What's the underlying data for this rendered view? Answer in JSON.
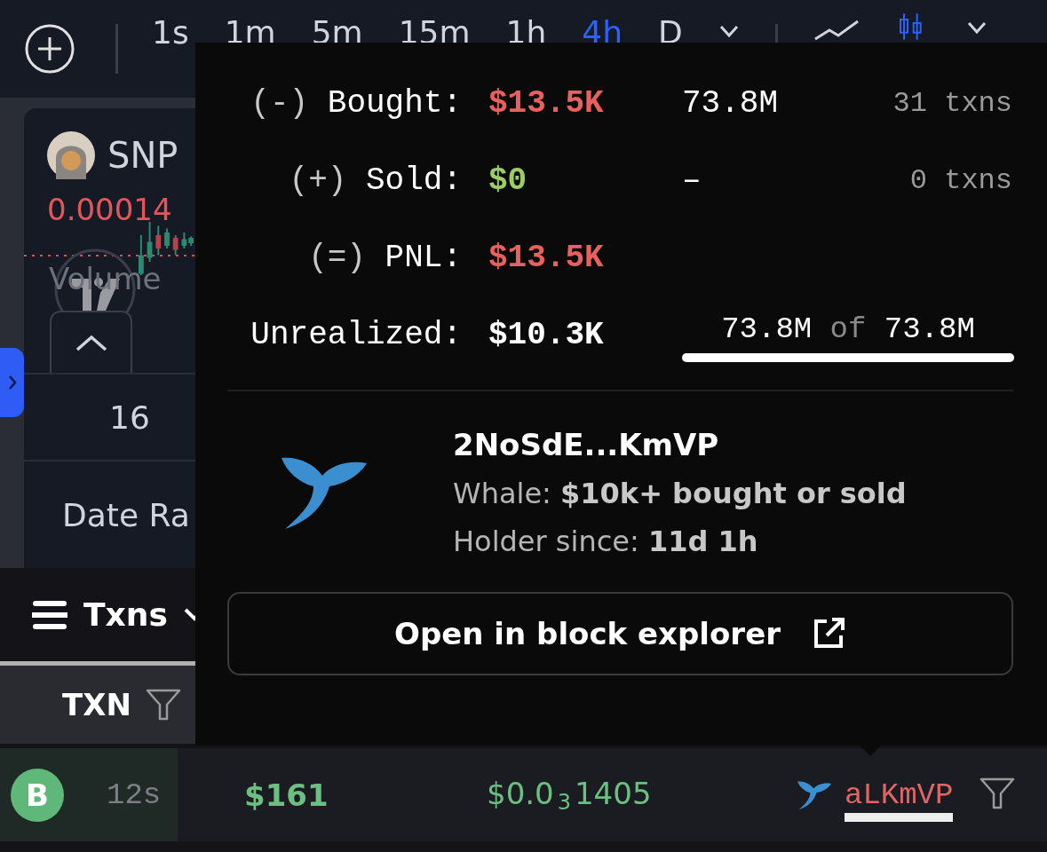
{
  "toolbar": {
    "intervals": [
      {
        "label": "1s",
        "selected": false
      },
      {
        "label": "1m",
        "selected": false
      },
      {
        "label": "5m",
        "selected": false
      },
      {
        "label": "15m",
        "selected": false
      },
      {
        "label": "1h",
        "selected": false
      },
      {
        "label": "4h",
        "selected": true
      },
      {
        "label": "D",
        "selected": false
      }
    ]
  },
  "chart": {
    "token": "SNP",
    "price": "0.00014",
    "volume_label": "Volume",
    "value": "16",
    "date_range": "Date Ra"
  },
  "txns_tab": {
    "label": "Txns"
  },
  "table": {
    "columns": [
      {
        "label": "TXN"
      }
    ],
    "rows": [
      {
        "kind": "buy",
        "badge": "B",
        "age": "12s",
        "usd": "$161",
        "price": "$0.0$_{3}$1405",
        "maker": "aLKmVP"
      }
    ]
  },
  "popup": {
    "stats": [
      {
        "sign": "(-)",
        "label": "Bought:",
        "value": "$13.5K",
        "color": "#e8615f",
        "amount": "73.8M",
        "txns": "31 txns"
      },
      {
        "sign": "(+)",
        "label": "Sold:",
        "value": "$0",
        "color": "#9ccc65",
        "amount": "–",
        "txns": "0 txns"
      },
      {
        "sign": "(=)",
        "label": "PNL:",
        "value": "$13.5K",
        "color": "#e8615f"
      },
      {
        "label": "Unrealized:",
        "value": "$10.3K",
        "color": "#ffffff"
      }
    ],
    "holding": {
      "amount": "73.8M",
      "of": "of",
      "total": "73.8M",
      "level": 1
    },
    "wallet": {
      "address": "2NoSdE...KmVP",
      "whale": "Whale: **$10k+ bought or sold**",
      "holder_since": "Holder since: **11d 1h**"
    },
    "button": "Open in block explorer"
  }
}
